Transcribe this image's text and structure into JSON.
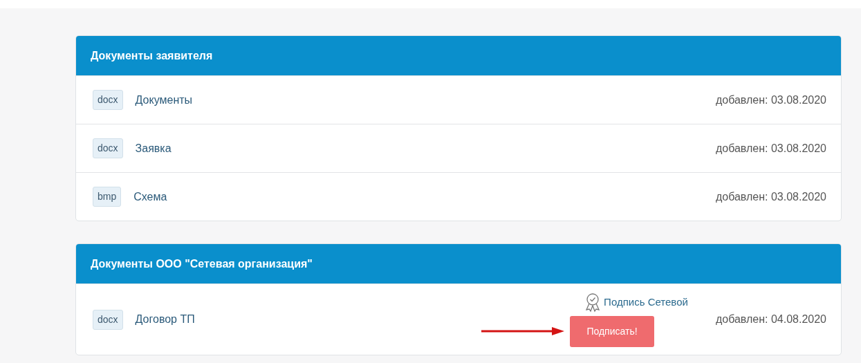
{
  "sections": [
    {
      "title": "Документы заявителя",
      "documents": [
        {
          "ext": "docx",
          "name": "Документы",
          "added": "добавлен: 03.08.2020"
        },
        {
          "ext": "docx",
          "name": "Заявка",
          "added": "добавлен: 03.08.2020"
        },
        {
          "ext": "bmp",
          "name": "Схема",
          "added": "добавлен: 03.08.2020"
        }
      ]
    },
    {
      "title": "Документы ООО \"Сетевая организация\"",
      "documents": [
        {
          "ext": "docx",
          "name": "Договор ТП",
          "added": "добавлен: 04.08.2020",
          "signature": "Подпись Сетевой",
          "sign_button": "Подписать!",
          "arrow_annotation": true
        }
      ]
    }
  ]
}
